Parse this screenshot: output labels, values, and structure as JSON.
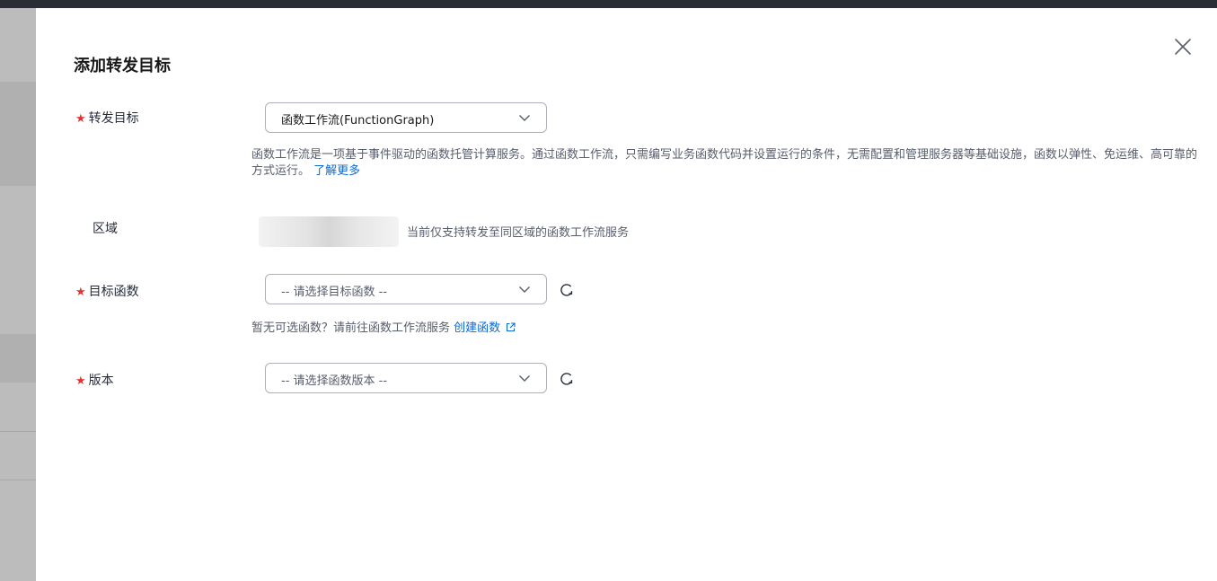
{
  "dialog": {
    "title": "添加转发目标"
  },
  "form": {
    "target": {
      "label": "转发目标",
      "value": "函数工作流(FunctionGraph)",
      "description": "函数工作流是一项基于事件驱动的函数托管计算服务。通过函数工作流，只需编写业务函数代码并设置运行的条件，无需配置和管理服务器等基础设施，函数以弹性、免运维、高可靠的方式运行。",
      "learn_more": "了解更多"
    },
    "region": {
      "label": "区域",
      "note": "当前仅支持转发至同区域的函数工作流服务"
    },
    "function": {
      "label": "目标函数",
      "placeholder": "-- 请选择目标函数 --",
      "hint": "暂无可选函数？请前往函数工作流服务",
      "create_link": "创建函数"
    },
    "version": {
      "label": "版本",
      "placeholder": "-- 请选择函数版本 --"
    }
  },
  "colors": {
    "required_star": "#e6302e",
    "link": "#0a69d5",
    "border": "#adb0b8",
    "topbar": "#2a2d36"
  },
  "icons": {
    "close": "close-icon",
    "chevron": "chevron-down-icon",
    "refresh": "refresh-icon",
    "external": "external-link-icon"
  }
}
